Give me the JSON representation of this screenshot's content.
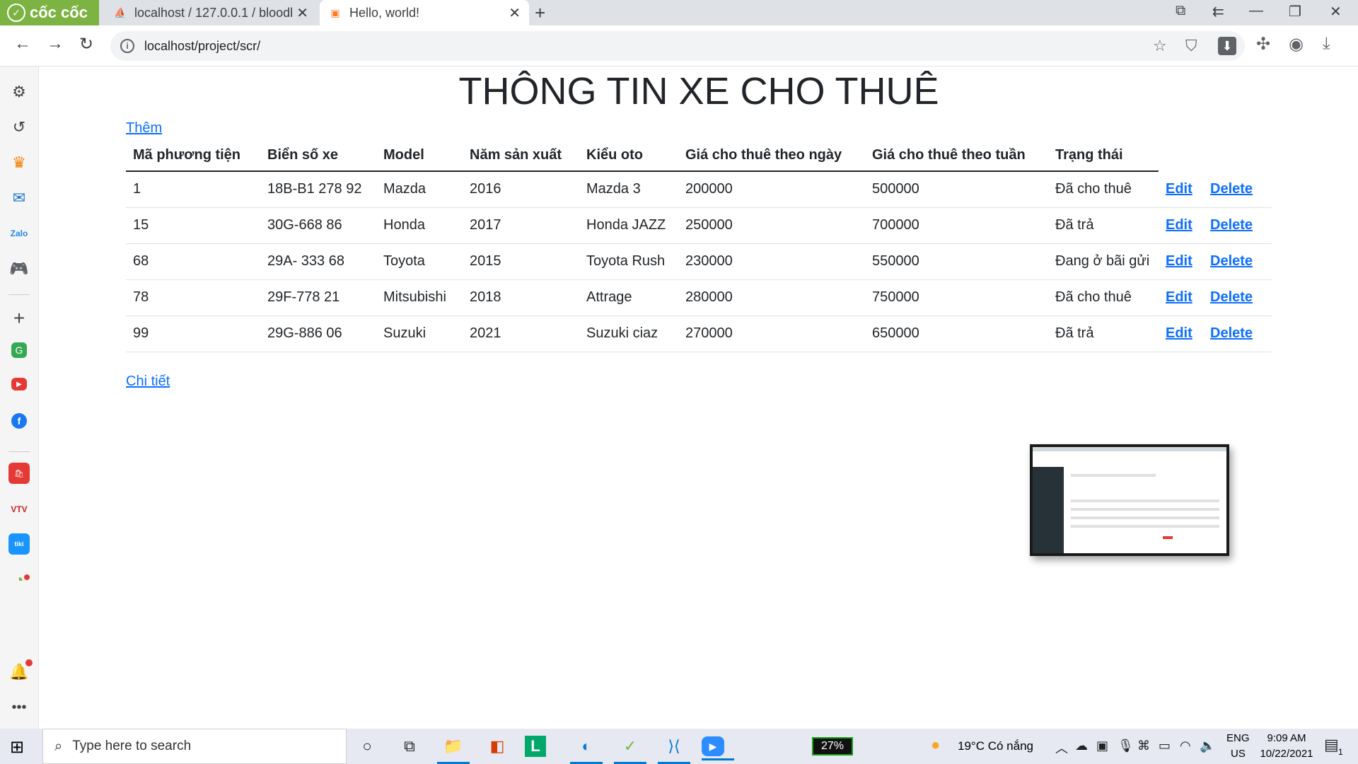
{
  "browser": {
    "brand": "cốc cốc",
    "tabs": [
      {
        "title": "localhost / 127.0.0.1 / bloodb",
        "favicon": "phpmyadmin-icon"
      },
      {
        "title": "Hello, world!",
        "favicon": "xampp-icon"
      }
    ],
    "url": "localhost/project/scr/"
  },
  "page": {
    "title": "THÔNG TIN XE CHO THUÊ",
    "add_link": "Thêm",
    "detail_link": "Chi tiết",
    "table": {
      "headers": [
        "Mã phương tiện",
        "Biển số xe",
        "Model",
        "Năm sản xuất",
        "Kiểu oto",
        "Giá cho thuê theo ngày",
        "Giá cho thuê theo tuần",
        "Trạng thái"
      ],
      "edit_label": "Edit",
      "delete_label": "Delete",
      "rows": [
        [
          "1",
          "18B-B1 278 92",
          "Mazda",
          "2016",
          "Mazda 3",
          "200000",
          "500000",
          "Đã cho thuê"
        ],
        [
          "15",
          "30G-668 86",
          "Honda",
          "2017",
          "Honda JAZZ",
          "250000",
          "700000",
          "Đã trả"
        ],
        [
          "68",
          "29A- 333 68",
          "Toyota",
          "2015",
          "Toyota Rush",
          "230000",
          "550000",
          "Đang ở bãi gửi"
        ],
        [
          "78",
          "29F-778 21",
          "Mitsubishi",
          "2018",
          "Attrage",
          "280000",
          "750000",
          "Đã cho thuê"
        ],
        [
          "99",
          "29G-886 06",
          "Suzuki",
          "2021",
          "Suzuki ciaz",
          "270000",
          "650000",
          "Đã trả"
        ]
      ]
    }
  },
  "taskbar": {
    "search_placeholder": "Type here to search",
    "battery": "27%",
    "weather": "19°C  Có nắng",
    "lang_top": "ENG",
    "lang_bottom": "US",
    "time": "9:09 AM",
    "date": "10/22/2021",
    "notification_count": "1"
  },
  "colors": {
    "brand_green": "#7cb342",
    "link_blue": "#0d6efd",
    "taskbar": "#e6e9f2"
  }
}
